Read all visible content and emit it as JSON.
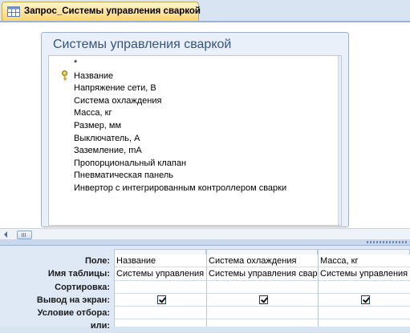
{
  "document": {
    "tab_title": "Запрос_Системы управления сваркой",
    "tab_icon": "query-icon"
  },
  "field_list": {
    "title": "Системы управления сваркой",
    "fields": [
      "*",
      "Название",
      "Напряжение сети, В",
      "Система охлаждения",
      "Масса, кг",
      "Размер, мм",
      "Выключатель, А",
      "Заземление, mA",
      "Пропорциональный клапан",
      "Пневматическая панель",
      "Инвертор с интегрированным контроллером сварки"
    ],
    "primary_key_field": "Название",
    "key_icon": "primary-key-icon"
  },
  "grid": {
    "row_labels": [
      "Поле:",
      "Имя таблицы:",
      "Сортировка:",
      "Вывод на экран:",
      "Условие отбора:",
      "или:"
    ],
    "columns": [
      {
        "field": "Название",
        "table": "Системы управления",
        "sort": "",
        "show": true,
        "criteria": "",
        "or": ""
      },
      {
        "field": "Система охлаждения",
        "table": "Системы управления свар",
        "sort": "",
        "show": true,
        "criteria": "",
        "or": ""
      },
      {
        "field": "Масса, кг",
        "table": "Системы управления",
        "sort": "",
        "show": true,
        "criteria": "",
        "or": ""
      }
    ]
  },
  "colors": {
    "tab_active": "#fde39a",
    "pane_background": "#d9e4f2",
    "field_list_title": "#34547f"
  }
}
